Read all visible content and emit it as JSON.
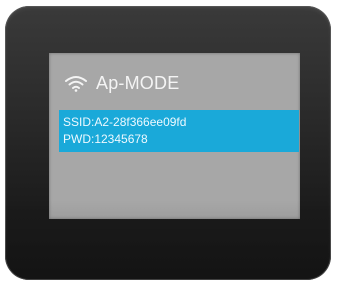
{
  "screen": {
    "title": "Ap-MODE",
    "ssid": "SSID:A2-28f366ee09fd",
    "password": "PWD:12345678"
  },
  "icons": {
    "title_icon": "wifi-icon"
  },
  "colors": {
    "screen_background": "#a7a7a7",
    "highlight": "#1aa9d9",
    "text": "#f4f4f4",
    "device_body": "#2a2a2a"
  }
}
